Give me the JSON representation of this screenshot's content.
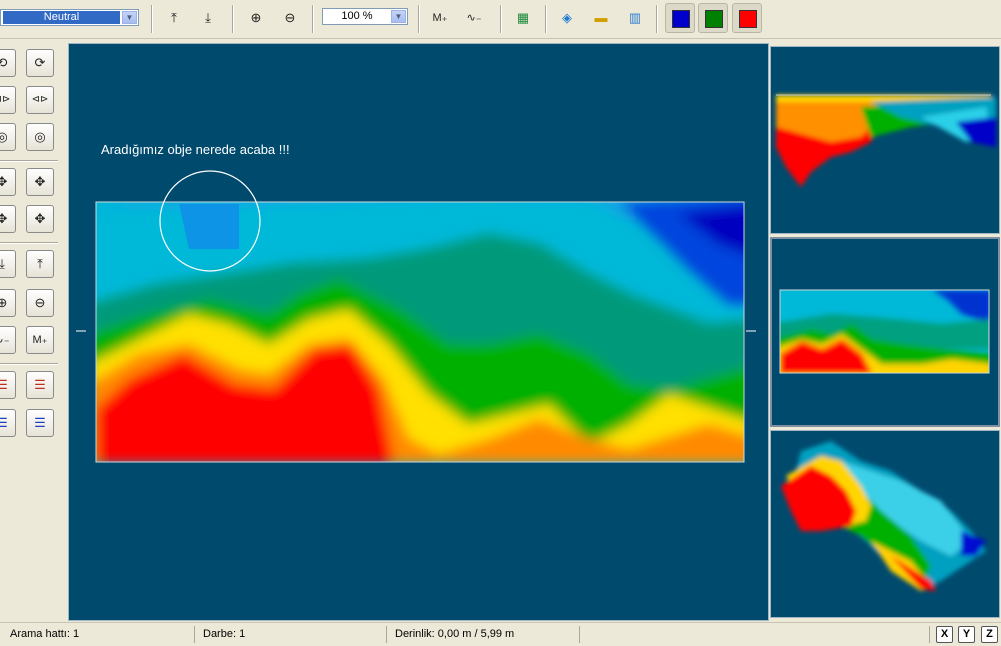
{
  "toolbar": {
    "mode": {
      "value": "Neutral"
    },
    "zoom": {
      "value": "100 %"
    },
    "icons": [
      {
        "name": "arrow-up-icon",
        "glyph": "⤒"
      },
      {
        "name": "arrow-down-icon",
        "glyph": "⤓"
      },
      {
        "name": "zoom-in-icon",
        "glyph": "⊕"
      },
      {
        "name": "zoom-out-icon",
        "glyph": "⊖"
      },
      {
        "name": "marker-plus-icon",
        "glyph": "M₊"
      },
      {
        "name": "marker-minus-icon",
        "glyph": "∿₋"
      },
      {
        "name": "map-view-icon",
        "glyph": "▦"
      },
      {
        "name": "surface-3d-icon",
        "glyph": "◈"
      },
      {
        "name": "layer-profile-icon",
        "glyph": "▬"
      },
      {
        "name": "depth-map-icon",
        "glyph": "▥"
      }
    ],
    "colors": [
      {
        "name": "blue-color-button",
        "hex": "#0000cc"
      },
      {
        "name": "green-color-button",
        "hex": "#008000"
      },
      {
        "name": "red-color-button",
        "hex": "#ff0000"
      }
    ]
  },
  "sidebar": {
    "buttons": [
      {
        "name": "rotate-left-icon",
        "glyph": "⟲"
      },
      {
        "name": "rotate-right-icon",
        "glyph": "⟳"
      },
      {
        "name": "flip-horizontal-icon",
        "glyph": "⊲⊳"
      },
      {
        "name": "flip-horizontal-alt-icon",
        "glyph": "⊲⊳"
      },
      {
        "name": "rotate-center-icon",
        "glyph": "◎"
      },
      {
        "name": "rotate-center-alt-icon",
        "glyph": "◎"
      },
      {
        "name": "move-icon",
        "glyph": "✥"
      },
      {
        "name": "move-alt-icon",
        "glyph": "✥"
      },
      {
        "name": "pan-icon",
        "glyph": "✥"
      },
      {
        "name": "pan-alt-icon",
        "glyph": "✥"
      },
      {
        "name": "arrow-down-icon",
        "glyph": "⤓"
      },
      {
        "name": "arrow-up-icon",
        "glyph": "⤒"
      },
      {
        "name": "zoom-in-icon",
        "glyph": "⊕"
      },
      {
        "name": "zoom-out-icon",
        "glyph": "⊖"
      },
      {
        "name": "marker-minus-icon",
        "glyph": "∿₋"
      },
      {
        "name": "marker-plus-icon",
        "glyph": "M₊"
      },
      {
        "name": "color-bars-icon",
        "glyph": "☰"
      },
      {
        "name": "color-bars-down-icon",
        "glyph": "☰"
      },
      {
        "name": "color-bars-up-icon",
        "glyph": "☰"
      },
      {
        "name": "color-bars-alt-icon",
        "glyph": "☰"
      }
    ]
  },
  "canvas": {
    "caption": "Aradığımız obje nerede acaba !!!"
  },
  "colors": {
    "background": "#004a6e",
    "red": "#ff0000",
    "orange": "#ff9900",
    "yellow": "#ffff00",
    "green": "#00a000",
    "cyan": "#00c8e0",
    "blue": "#0000cc"
  },
  "status": {
    "line": "Arama hattı: 1",
    "shot": "Darbe: 1",
    "depth": "Derinlik: 0,00 m / 5,99 m",
    "axes": [
      "X",
      "Y",
      "Z"
    ]
  }
}
